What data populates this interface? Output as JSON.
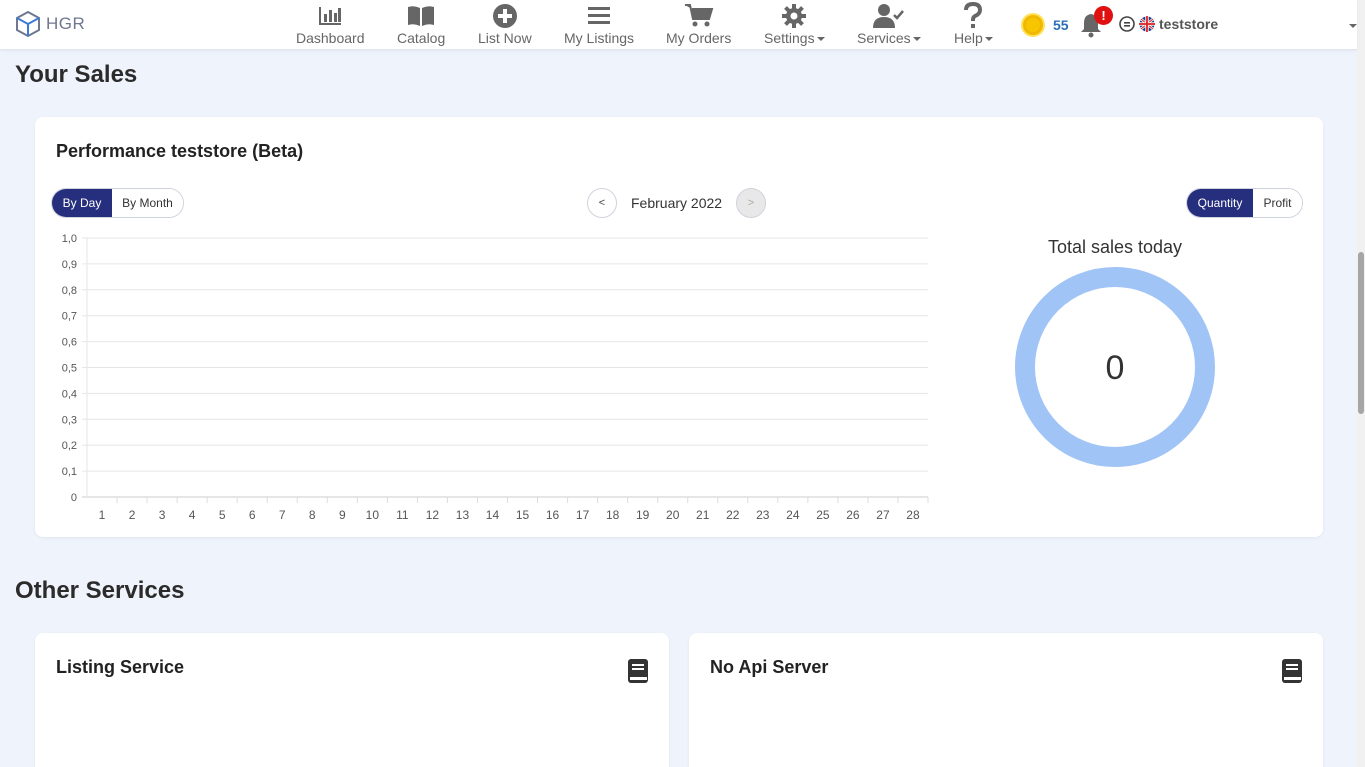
{
  "app": {
    "name": "HGR"
  },
  "nav": [
    {
      "label": "Dashboard",
      "icon": "bar-chart-icon",
      "dropdown": false
    },
    {
      "label": "Catalog",
      "icon": "book-open-icon",
      "dropdown": false
    },
    {
      "label": "List Now",
      "icon": "plus-circle-icon",
      "dropdown": false
    },
    {
      "label": "My Listings",
      "icon": "menu-lines-icon",
      "dropdown": false
    },
    {
      "label": "My Orders",
      "icon": "cart-icon",
      "dropdown": false
    },
    {
      "label": "Settings",
      "icon": "gear-icon",
      "dropdown": true
    },
    {
      "label": "Services",
      "icon": "user-check-icon",
      "dropdown": true
    },
    {
      "label": "Help",
      "icon": "question-icon",
      "dropdown": true
    }
  ],
  "header": {
    "coins": "55",
    "notification_badge": "!",
    "username": "teststore"
  },
  "sales": {
    "section_title": "Your Sales",
    "card_title": "Performance teststore (Beta)",
    "period_toggle": {
      "by_day": "By Day",
      "by_month": "By Month",
      "active": "By Day"
    },
    "month_nav": {
      "prev": "<",
      "next": ">",
      "current": "February 2022"
    },
    "metric_toggle": {
      "quantity": "Quantity",
      "profit": "Profit",
      "active": "Quantity"
    },
    "donut": {
      "title": "Total sales today",
      "value": "0",
      "color": "#a0c4f5"
    }
  },
  "chart_data": {
    "type": "bar",
    "categories": [
      "1",
      "2",
      "3",
      "4",
      "5",
      "6",
      "7",
      "8",
      "9",
      "10",
      "11",
      "12",
      "13",
      "14",
      "15",
      "16",
      "17",
      "18",
      "19",
      "20",
      "21",
      "22",
      "23",
      "24",
      "25",
      "26",
      "27",
      "28"
    ],
    "values": [
      0,
      0,
      0,
      0,
      0,
      0,
      0,
      0,
      0,
      0,
      0,
      0,
      0,
      0,
      0,
      0,
      0,
      0,
      0,
      0,
      0,
      0,
      0,
      0,
      0,
      0,
      0,
      0
    ],
    "ylim": [
      0,
      1
    ],
    "yticks": [
      "0",
      "0,1",
      "0,2",
      "0,3",
      "0,4",
      "0,5",
      "0,6",
      "0,7",
      "0,8",
      "0,9",
      "1,0"
    ],
    "grid": true
  },
  "other": {
    "section_title": "Other Services",
    "cards": [
      {
        "title": "Listing Service"
      },
      {
        "title": "No Api Server"
      }
    ]
  },
  "colors": {
    "primary": "#262f7e",
    "accent_blue": "#2b6fb6",
    "badge": "#e01010",
    "donut": "#a0c4f5"
  }
}
